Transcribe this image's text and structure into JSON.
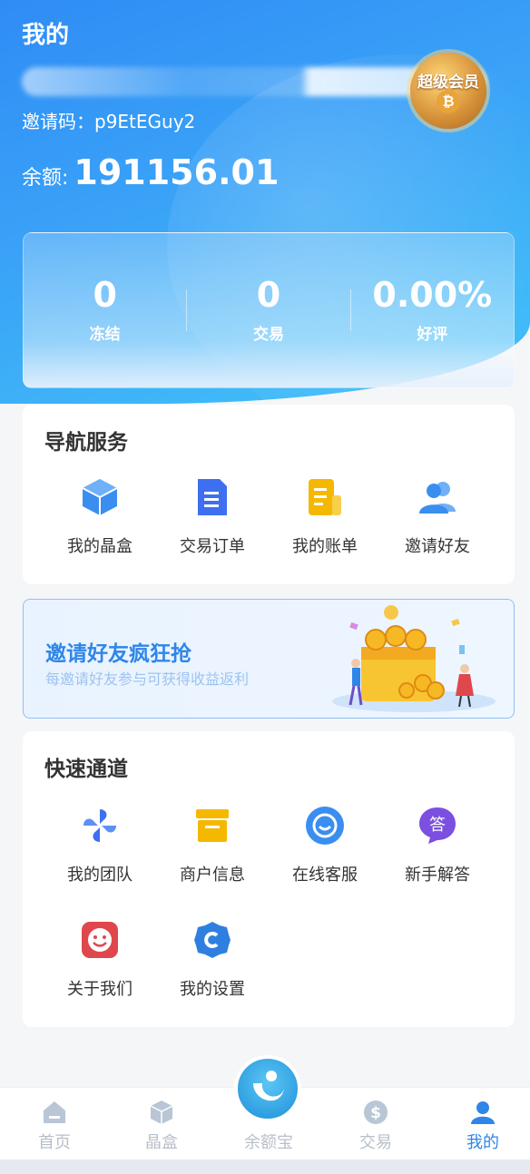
{
  "header": {
    "title": "我的",
    "invite_code": "邀请码：p9EtEGuy2",
    "balance_label": "余额:",
    "balance_value": "191156.01",
    "vip_label": "超级会员"
  },
  "stats": [
    {
      "value": "0",
      "label": "冻结"
    },
    {
      "value": "0",
      "label": "交易"
    },
    {
      "value": "0.00%",
      "label": "好评"
    }
  ],
  "nav_services": {
    "title": "导航服务",
    "items": [
      {
        "label": "我的晶盒",
        "icon": "cube-icon",
        "color": "#3a8ef0"
      },
      {
        "label": "交易订单",
        "icon": "document-icon",
        "color": "#3d6ff0"
      },
      {
        "label": "我的账单",
        "icon": "bill-icon",
        "color": "#f5b800"
      },
      {
        "label": "邀请好友",
        "icon": "users-icon",
        "color": "#3a8ef0"
      }
    ]
  },
  "promo": {
    "title": "邀请好友疯狂抢",
    "subtitle": "每邀请好友参与可获得收益返利"
  },
  "quick_access": {
    "title": "快速通道",
    "items": [
      {
        "label": "我的团队",
        "icon": "team-icon",
        "color": "#3d6ff0"
      },
      {
        "label": "商户信息",
        "icon": "shop-icon",
        "color": "#f5b800"
      },
      {
        "label": "在线客服",
        "icon": "chat-icon",
        "color": "#3a8ef0"
      },
      {
        "label": "新手解答",
        "icon": "answer-icon",
        "color": "#7b4fe0"
      },
      {
        "label": "关于我们",
        "icon": "smile-icon",
        "color": "#e0474c"
      },
      {
        "label": "我的设置",
        "icon": "settings-icon",
        "color": "#2f7fe0"
      }
    ]
  },
  "bottom_nav": {
    "items": [
      {
        "label": "首页",
        "icon": "home-icon"
      },
      {
        "label": "晶盒",
        "icon": "cube-icon"
      },
      {
        "label": "余额宝",
        "icon": "yuebao-icon"
      },
      {
        "label": "交易",
        "icon": "dollar-icon"
      },
      {
        "label": "我的",
        "icon": "profile-icon"
      }
    ],
    "active": "我的",
    "active_color": "#2f86e8",
    "inactive_color": "#b8bfc8"
  }
}
